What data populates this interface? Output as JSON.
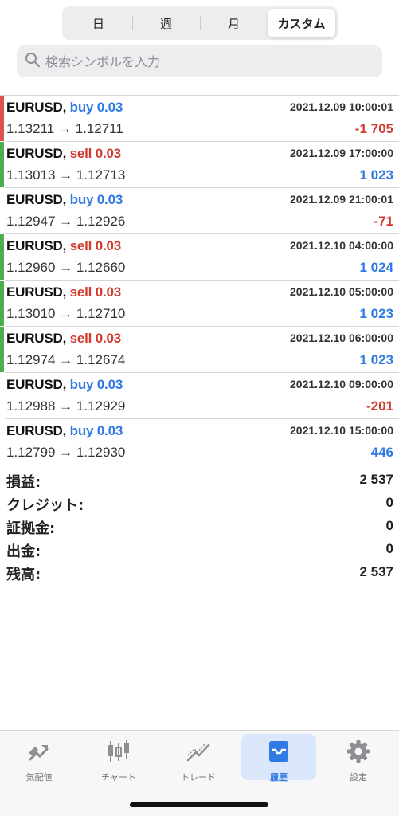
{
  "period_tabs": [
    {
      "label": "日",
      "active": false
    },
    {
      "label": "週",
      "active": false
    },
    {
      "label": "月",
      "active": false
    },
    {
      "label": "カスタム",
      "active": true
    }
  ],
  "search": {
    "placeholder": "検索シンボルを入力",
    "value": ""
  },
  "trades": [
    {
      "symbol": "EURUSD,",
      "side": "buy",
      "volume": "0.03",
      "side_label": "buy 0.03",
      "time": "2021.12.09 10:00:01",
      "prices": "1.13211 → 1.12711",
      "profit": "-1 705",
      "bar_color": "#d9534f"
    },
    {
      "symbol": "EURUSD,",
      "side": "sell",
      "volume": "0.03",
      "side_label": "sell 0.03",
      "time": "2021.12.09 17:00:00",
      "prices": "1.13013 → 1.12713",
      "profit": "1 023",
      "bar_color": "#4cae4c"
    },
    {
      "symbol": "EURUSD,",
      "side": "buy",
      "volume": "0.03",
      "side_label": "buy 0.03",
      "time": "2021.12.09 21:00:01",
      "prices": "1.12947 → 1.12926",
      "profit": "-71",
      "bar_color": ""
    },
    {
      "symbol": "EURUSD,",
      "side": "sell",
      "volume": "0.03",
      "side_label": "sell 0.03",
      "time": "2021.12.10 04:00:00",
      "prices": "1.12960 → 1.12660",
      "profit": "1 024",
      "bar_color": "#4cae4c"
    },
    {
      "symbol": "EURUSD,",
      "side": "sell",
      "volume": "0.03",
      "side_label": "sell 0.03",
      "time": "2021.12.10 05:00:00",
      "prices": "1.13010 → 1.12710",
      "profit": "1 023",
      "bar_color": "#4cae4c"
    },
    {
      "symbol": "EURUSD,",
      "side": "sell",
      "volume": "0.03",
      "side_label": "sell 0.03",
      "time": "2021.12.10 06:00:00",
      "prices": "1.12974 → 1.12674",
      "profit": "1 023",
      "bar_color": "#4cae4c"
    },
    {
      "symbol": "EURUSD,",
      "side": "buy",
      "volume": "0.03",
      "side_label": "buy 0.03",
      "time": "2021.12.10 09:00:00",
      "prices": "1.12988 → 1.12929",
      "profit": "-201",
      "bar_color": ""
    },
    {
      "symbol": "EURUSD,",
      "side": "buy",
      "volume": "0.03",
      "side_label": "buy 0.03",
      "time": "2021.12.10 15:00:00",
      "prices": "1.12799 → 1.12930",
      "profit": "446",
      "bar_color": ""
    }
  ],
  "summary": [
    {
      "label": "損益:",
      "value": "2 537"
    },
    {
      "label": "クレジット:",
      "value": "0"
    },
    {
      "label": "証拠金:",
      "value": "0"
    },
    {
      "label": "出金:",
      "value": "0"
    },
    {
      "label": "残高:",
      "value": "2 537"
    }
  ],
  "tabbar": [
    {
      "label": "気配値",
      "icon": "quotes-icon",
      "active": false
    },
    {
      "label": "チャート",
      "icon": "candlestick-chart-icon",
      "active": false
    },
    {
      "label": "トレード",
      "icon": "trade-line-icon",
      "active": false
    },
    {
      "label": "履歴",
      "icon": "inbox-history-icon",
      "active": true
    },
    {
      "label": "設定",
      "icon": "gear-icon",
      "active": false
    }
  ],
  "colors": {
    "buy": "#2f7ae5",
    "sell": "#d23b2f",
    "active_tab": "#2f7ae5"
  }
}
